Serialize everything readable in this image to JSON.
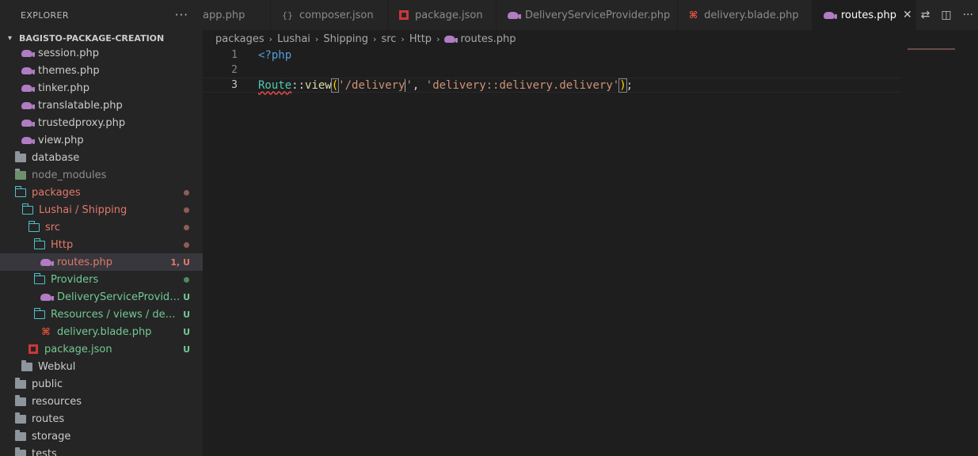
{
  "sidebar": {
    "title": "EXPLORER",
    "more": "···",
    "project": "BAGISTO-PACKAGE-CREATION",
    "items": [
      {
        "label": "session.php"
      },
      {
        "label": "themes.php"
      },
      {
        "label": "tinker.php"
      },
      {
        "label": "translatable.php"
      },
      {
        "label": "trustedproxy.php"
      },
      {
        "label": "view.php"
      },
      {
        "label": "database"
      },
      {
        "label": "node_modules"
      },
      {
        "label": "packages"
      },
      {
        "label": "Lushai / Shipping"
      },
      {
        "label": "src"
      },
      {
        "label": "Http"
      },
      {
        "label": "routes.php",
        "badge": "1, U"
      },
      {
        "label": "Providers"
      },
      {
        "label": "DeliveryServiceProvider...",
        "badge": "U"
      },
      {
        "label": "Resources / views / deliv...",
        "badge": "U"
      },
      {
        "label": "delivery.blade.php",
        "badge": "U"
      },
      {
        "label": "package.json",
        "badge": "U"
      },
      {
        "label": "Webkul"
      },
      {
        "label": "public"
      },
      {
        "label": "resources"
      },
      {
        "label": "routes"
      },
      {
        "label": "storage"
      },
      {
        "label": "tests"
      }
    ]
  },
  "tabs": [
    {
      "label": "app.php"
    },
    {
      "label": "composer.json"
    },
    {
      "label": "package.json"
    },
    {
      "label": "DeliveryServiceProvider.php"
    },
    {
      "label": "delivery.blade.php"
    },
    {
      "label": "routes.php",
      "close": "✕"
    }
  ],
  "breadcrumb": [
    "packages",
    "Lushai",
    "Shipping",
    "src",
    "Http",
    "routes.php"
  ],
  "editor": {
    "lines": [
      {
        "num": "1",
        "text": "<?php"
      },
      {
        "num": "2",
        "text": ""
      },
      {
        "num": "3",
        "route": "Route",
        "op": "::",
        "fn": "view",
        "lp": "(",
        "s1a": "'/delivery",
        "s1b": "'",
        "comma": ", ",
        "s2": "'delivery::delivery.delivery'",
        "rp": ")",
        "semi": ";"
      }
    ]
  },
  "colors": {
    "untracked": "#73c991",
    "modified": "#e2786a",
    "accent": "#569cd6"
  }
}
